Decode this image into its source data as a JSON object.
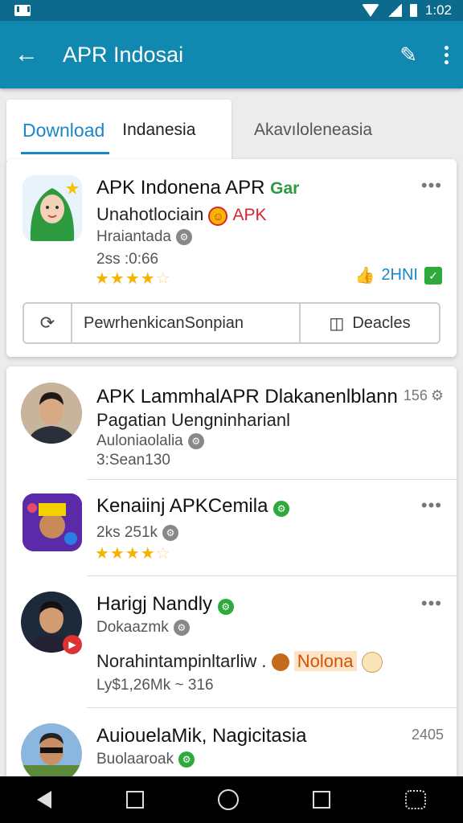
{
  "statusbar": {
    "time": "1:02",
    "icons": [
      "mail-icon",
      "wifi-icon",
      "signal-icon",
      "battery-icon"
    ]
  },
  "appbar": {
    "title": "APR Indosai",
    "back_icon": "arrow-left-icon",
    "edit_icon": "edit-icon",
    "more_icon": "more-vert-icon"
  },
  "tabs": [
    {
      "label": "Download",
      "active": true
    },
    {
      "label": "Indanesia"
    },
    {
      "label": "Akavıloleneasia"
    }
  ],
  "featured": {
    "name": "APK Indonena APR",
    "badge": "Gar",
    "line2": "Unahotlociain",
    "tag": "APK",
    "meta": "Hraiantada",
    "stat": "2ss   :0:66",
    "rating": 4,
    "thumbs_label": "2HNI",
    "action_mid": "PewrhenkicanSonpian",
    "action_right": "Deacles",
    "more": "•••"
  },
  "list": [
    {
      "name": "APK LammhalAPR Dlakanenlblann",
      "line2": "Pagatian Uengninharianl",
      "meta": "Auloniaolalia",
      "extra": "3:Sean130",
      "count": "156"
    },
    {
      "name": "Kenaiinj APKCemila",
      "meta": "2ks   251k",
      "rating": 4
    },
    {
      "name": "Harigj Nandly",
      "meta": "Dokaazmk",
      "line2": "Norahintampinltarliw .",
      "tag": "Nolona",
      "extra": "Ly$1,26Mk ~ 316"
    },
    {
      "name": "AuiouelaMik, Nagicitasia",
      "meta": "Buolaaroak",
      "count": "2405"
    }
  ],
  "colors": {
    "appbar": "#1188b0",
    "statusbar": "#0c6b8c",
    "accent": "#1a86c8",
    "star": "#f5b300",
    "verified": "#2eaa3c"
  }
}
